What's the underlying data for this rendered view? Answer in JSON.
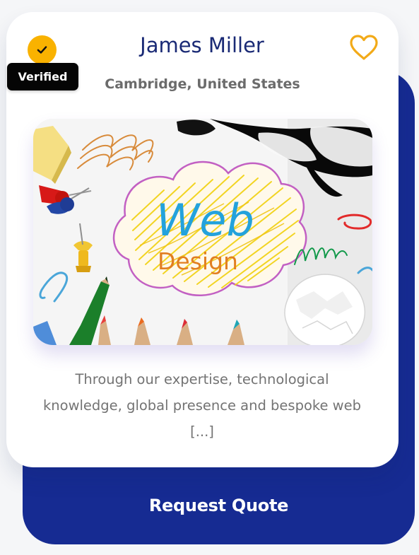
{
  "seller": {
    "name": "James Miller",
    "location": "Cambridge, United States",
    "badge": "Verified"
  },
  "listing": {
    "image_title": "Web",
    "image_subtitle": "Design",
    "description": "Through our expertise, technological knowledge, global presence and bespoke web [...]"
  },
  "actions": {
    "request_quote_label": "Request Quote",
    "favorite_icon": "heart-outline-icon",
    "verified_icon": "check-circle-icon"
  },
  "colors": {
    "page_background": "#f5f6f8",
    "card_background": "#ffffff",
    "backdrop": "#162b92",
    "accent": "#f9b200",
    "name_text": "#1a2a75"
  }
}
